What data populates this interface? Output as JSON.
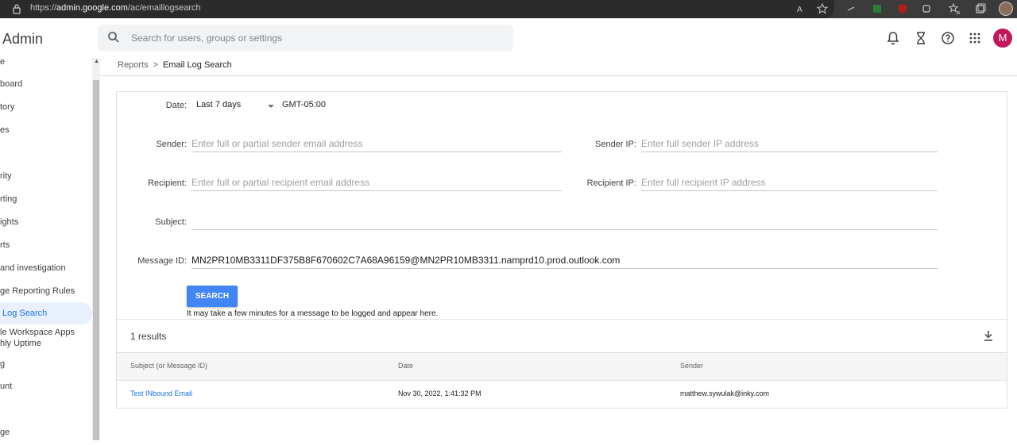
{
  "browser": {
    "url_prefix": "https://",
    "url_domain": "admin.google.com",
    "url_path": "/ac/emaillogsearch"
  },
  "header": {
    "brand": "Admin",
    "search_placeholder": "Search for users, groups or settings",
    "avatar_letter": "M"
  },
  "sidebar": {
    "items": [
      {
        "label": "e",
        "active": false
      },
      {
        "label": "board",
        "active": false
      },
      {
        "label": "tory",
        "active": false
      },
      {
        "label": "es",
        "active": false
      },
      {
        "label": "rity",
        "active": false
      },
      {
        "label": "rting",
        "active": false
      },
      {
        "label": "ights",
        "active": false
      },
      {
        "label": "rts",
        "active": false
      },
      {
        "label": "and investigation",
        "active": false
      },
      {
        "label": "ge Reporting Rules",
        "active": false
      },
      {
        "label": "Log Search",
        "active": true
      },
      {
        "label": "le Workspace Apps",
        "active": false
      },
      {
        "label": "hly Uptime",
        "active": false
      },
      {
        "label": "g",
        "active": false
      },
      {
        "label": "unt",
        "active": false
      },
      {
        "label": "ge",
        "active": false
      }
    ]
  },
  "breadcrumb": {
    "parent": "Reports",
    "separator": ">",
    "current": "Email Log Search"
  },
  "form": {
    "date_label": "Date:",
    "date_value": "Last 7 days",
    "timezone": "GMT-05:00",
    "sender_label": "Sender:",
    "sender_placeholder": "Enter full or partial sender email address",
    "sender_ip_label": "Sender IP:",
    "sender_ip_placeholder": "Enter full sender IP address",
    "recipient_label": "Recipient:",
    "recipient_placeholder": "Enter full or partial recipient email address",
    "recipient_ip_label": "Recipient IP:",
    "recipient_ip_placeholder": "Enter full recipient IP address",
    "subject_label": "Subject:",
    "subject_value": "",
    "message_id_label": "Message ID:",
    "message_id_value": "MN2PR10MB3311DF375B8F670602C7A68A96159@MN2PR10MB3311.namprd10.prod.outlook.com",
    "search_button": "SEARCH",
    "hint": "It may take a few minutes for a message to be logged and appear here."
  },
  "results": {
    "count_text": "1 results",
    "columns": [
      "Subject (or Message ID)",
      "Date",
      "Sender"
    ],
    "rows": [
      {
        "subject": "Test INbound Email",
        "date": "Nov 30, 2022, 1:41:32 PM",
        "sender": "matthew.sywulak@inky.com"
      }
    ]
  },
  "colors": {
    "accent": "#1a73e8",
    "button": "#4285f4",
    "avatar": "#c2185b",
    "active_nav_bg": "#e8f0fe"
  }
}
